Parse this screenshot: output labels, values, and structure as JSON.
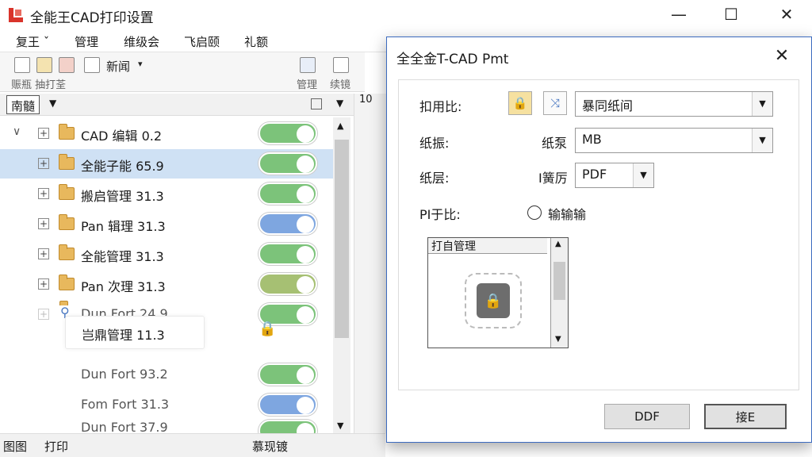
{
  "window": {
    "title": "全能王CAD打印设置",
    "minimize": "—",
    "maximize": "☐",
    "close": "✕"
  },
  "menu": [
    "复王 ˇ",
    "管理",
    "维级会",
    "飞启颐",
    "礼额"
  ],
  "toolbar": {
    "new_label": "新闻",
    "group_label": "赈瓶 抽打荃",
    "manage_label": "管理",
    "edit_label": "续镜"
  },
  "panel": {
    "tab_label": "南髓",
    "right_numbers": [
      "10"
    ]
  },
  "tree": {
    "rows": [
      {
        "label": "CAD 编辑 0.2",
        "toggle": "green",
        "expanded": true
      },
      {
        "label": "全能子能 65.9",
        "toggle": "green",
        "selected": true
      },
      {
        "label": "搬启管理 31.3",
        "toggle": "green"
      },
      {
        "label": "Pan 辑理 31.3",
        "toggle": "blue"
      },
      {
        "label": "全能管理 31.3",
        "toggle": "green"
      },
      {
        "label": "Pan 次理 31.3",
        "toggle": "olive"
      },
      {
        "label": "Dun Fort 24.9",
        "toggle": "green",
        "faded": true
      },
      {
        "label": "Dun Fort 93.2",
        "toggle": "green",
        "faded": true
      },
      {
        "label": "Fom Fort 31.3",
        "toggle": "blue",
        "faded": true
      },
      {
        "label": "Dun Fort 37.9",
        "toggle": "green",
        "faded": true
      }
    ],
    "ghost_card_label": "岂鼎管理 11.3"
  },
  "statusbar": {
    "left": "图图",
    "print": "打印",
    "center": "慕现镀"
  },
  "dialog": {
    "title": "全全金T-CAD Pmt",
    "close": "✕",
    "fields": {
      "ratio_label": "扣用比:",
      "ratio_value": "暴同纸间",
      "paper_label": "纸振:",
      "paper_sub_label": "纸泵",
      "paper_value": "MB",
      "layer_label": "纸层:",
      "layer_sub_label": "I簧厉",
      "layer_value": "PDF",
      "pdf_ratio_label": "PI于比:",
      "radio_label": "输输输"
    },
    "preview_header": "打自管理",
    "buttons": {
      "secondary": "DDF",
      "primary": "接E"
    }
  },
  "colors": {
    "green": "#7cc37a",
    "blue": "#7ea6e0",
    "olive": "#a6c073",
    "selected": "#cfe1f4"
  }
}
